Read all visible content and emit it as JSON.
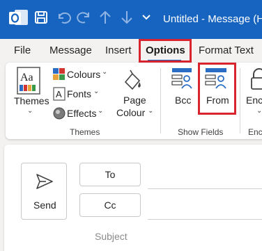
{
  "window": {
    "title": "Untitled  -  Message (HT"
  },
  "tabs": [
    {
      "label": "File"
    },
    {
      "label": "Message"
    },
    {
      "label": "Insert"
    },
    {
      "label": "Options"
    },
    {
      "label": "Format Text"
    }
  ],
  "ribbon": {
    "themes_label": "Themes",
    "colours_label": "Colours",
    "fonts_label": "Fonts",
    "effects_label": "Effects",
    "page_colour_line1": "Page",
    "page_colour_line2": "Colour",
    "themes_group": "Themes",
    "bcc_label": "Bcc",
    "from_label": "From",
    "show_fields_group": "Show Fields",
    "encrypt_label": "Encr",
    "encrypt_group": "Encr"
  },
  "compose": {
    "send_label": "Send",
    "to_label": "To",
    "cc_label": "Cc",
    "subject_label": "Subject"
  },
  "colors": {
    "titlebar": "#1664c0",
    "highlight": "#d8242e"
  }
}
